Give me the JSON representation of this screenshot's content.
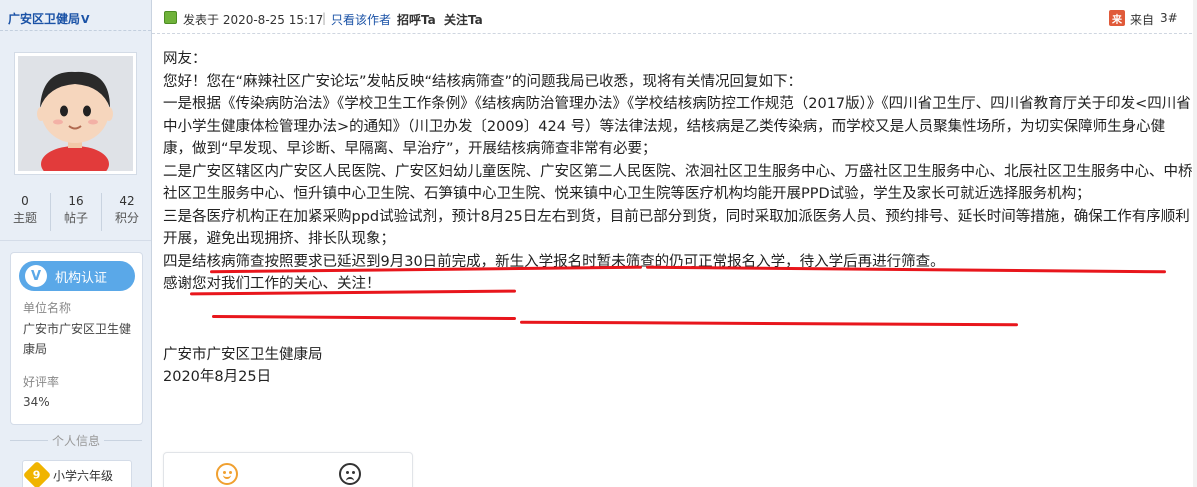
{
  "author": {
    "name": "广安区卫健局",
    "verified_mark": "V",
    "avatar": "cartoon-avatar",
    "stats": [
      {
        "value": "0",
        "label": "主题"
      },
      {
        "value": "16",
        "label": "帖子"
      },
      {
        "value": "42",
        "label": "积分"
      }
    ],
    "verify": {
      "button_label": "机构认证",
      "unit_label": "单位名称",
      "unit_value": "广安市广安区卫生健康局",
      "rating_label": "好评率",
      "rating_value": "34%"
    },
    "info_title": "个人信息",
    "level": {
      "badge": "9",
      "label": "小学六年级"
    }
  },
  "post_header": {
    "posted_at": "发表于 2020-8-25 15:17",
    "separator": "|",
    "only_author": "只看该作者",
    "greet": "招呼Ta",
    "follow": "关注Ta",
    "from_icon": "来",
    "from_label": "来自",
    "floor": "3#"
  },
  "post_body": {
    "greeting": "网友：",
    "intro": "您好！您在“麻辣社区广安论坛”发帖反映“结核病筛查”的问题我局已收悉，现将有关情况回复如下：",
    "p1": "一是根据《传染病防治法》《学校卫生工作条例》《结核病防治管理办法》《学校结核病防控工作规范（2017版）》《四川省卫生厅、四川省教育厅关于印发<四川省中小学生健康体检管理办法>的通知》（川卫办发〔2009〕424 号）等法律法规，结核病是乙类传染病，而学校又是人员聚集性场所，为切实保障师生身心健康，做到“早发现、早诊断、早隔离、早治疗”，开展结核病筛查非常有必要；",
    "p2": "二是广安区辖区内广安区人民医院、广安区妇幼儿童医院、广安区第二人民医院、浓洄社区卫生服务中心、万盛社区卫生服务中心、北辰社区卫生服务中心、中桥社区卫生服务中心、恒升镇中心卫生院、石笋镇中心卫生院、悦来镇中心卫生院等医疗机构均能开展PPD试验，学生及家长可就近选择服务机构；",
    "p3": "三是各医疗机构正在加紧采购ppd试验试剂，预计8月25日左右到货，目前已部分到货，同时采取加派医务人员、预约排号、延长时间等措施，确保工作有序顺利开展，避免出现拥挤、排长队现象；",
    "p4": "四是结核病筛查按照要求已延迟到9月30日前完成，新生入学报名时暂未筛查的仍可正常报名入学，待入学后再进行筛查。",
    "thanks": "感谢您对我们工作的关心、关注！",
    "signature": "广安市广安区卫生健康局",
    "date": "2020年8月25日"
  },
  "reactions": [
    "smile-icon",
    "frown-icon"
  ],
  "colors": {
    "link": "#1a52a6",
    "annotation_red": "#e8161c",
    "sidebar_bg": "#e8eef6",
    "verify_blue": "#5aa8e8"
  }
}
